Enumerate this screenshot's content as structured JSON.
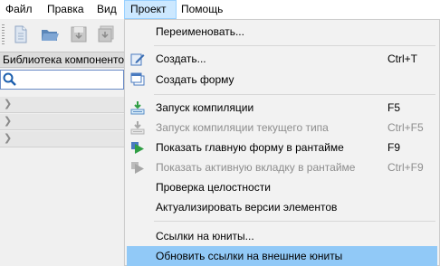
{
  "menubar": {
    "items": [
      {
        "label": "Файл"
      },
      {
        "label": "Правка"
      },
      {
        "label": "Вид"
      },
      {
        "label": "Проект"
      },
      {
        "label": "Помощь"
      }
    ]
  },
  "toolbar": {
    "buttons": [
      {
        "icon": "new-document-icon"
      },
      {
        "icon": "open-folder-icon"
      },
      {
        "icon": "save-icon"
      },
      {
        "icon": "save-all-icon"
      }
    ]
  },
  "library": {
    "header": "Библиотека компонентов",
    "search_value": ""
  },
  "project_menu": {
    "items": [
      {
        "label": "Переименовать...",
        "shortcut": ""
      },
      {
        "label": "Создать...",
        "shortcut": "Ctrl+T"
      },
      {
        "label": "Создать форму",
        "shortcut": ""
      },
      {
        "label": "Запуск компиляции",
        "shortcut": "F5"
      },
      {
        "label": "Запуск компиляции текущего типа",
        "shortcut": "Ctrl+F5"
      },
      {
        "label": "Показать главную форму в рантайме",
        "shortcut": "F9"
      },
      {
        "label": "Показать активную вкладку в рантайме",
        "shortcut": "Ctrl+F9"
      },
      {
        "label": "Проверка целостности",
        "shortcut": ""
      },
      {
        "label": "Актуализировать версии элементов",
        "shortcut": ""
      },
      {
        "label": "Ссылки на юниты...",
        "shortcut": ""
      },
      {
        "label": "Обновить ссылки на внешние юниты",
        "shortcut": ""
      }
    ]
  },
  "colors": {
    "menu_highlight": "#91c9f7",
    "active_menubar": "#cce8ff",
    "disabled_text": "#8d8d8d"
  }
}
